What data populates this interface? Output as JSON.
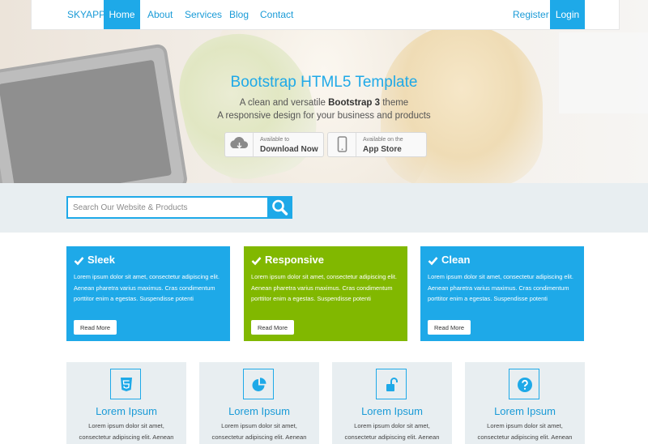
{
  "nav": {
    "brand": "SKYAPP",
    "items": [
      {
        "label": "Home"
      },
      {
        "label": "About"
      },
      {
        "label": "Services"
      },
      {
        "label": "Blog"
      },
      {
        "label": "Contact"
      }
    ],
    "register": "Register",
    "login": "Login"
  },
  "hero": {
    "title": "Bootstrap HTML5 Template",
    "subtitle1_pre": "A clean and versatile ",
    "subtitle1_bold": "Bootstrap 3",
    "subtitle1_post": " theme",
    "subtitle2": "A responsive design for your business and products",
    "download": {
      "small": "Available to",
      "big": "Download Now",
      "icon": "cloud-download-icon"
    },
    "appstore": {
      "small": "Available on the",
      "big": "App Store",
      "icon": "mobile-phone-icon"
    }
  },
  "search": {
    "placeholder": "Search Our Website & Products",
    "icon": "search-icon"
  },
  "features": [
    {
      "title": "Sleek",
      "text": "Lorem ipsum dolor sit amet, consectetur adipiscing elit. Aenean pharetra varius maximus. Cras condimentum porttitor enim a egestas. Suspendisse potenti",
      "button": "Read More",
      "color": "#1ea9e8"
    },
    {
      "title": "Responsive",
      "text": "Lorem ipsum dolor sit amet, consectetur adipiscing elit. Aenean pharetra varius maximus. Cras condimentum porttitor enim a egestas. Suspendisse potenti",
      "button": "Read More",
      "color": "#81b800"
    },
    {
      "title": "Clean",
      "text": "Lorem ipsum dolor sit amet, consectetur adipiscing elit. Aenean pharetra varius maximus. Cras condimentum porttitor enim a egestas. Suspendisse potenti",
      "button": "Read More",
      "color": "#1ea9e8"
    }
  ],
  "tiles": [
    {
      "title": "Lorem Ipsum",
      "text1": "Lorem ipsum dolor sit amet,",
      "text2": "consectetur adipiscing elit. Aenean",
      "icon": "html5-icon"
    },
    {
      "title": "Lorem Ipsum",
      "text1": "Lorem ipsum dolor sit amet,",
      "text2": "consectetur adipiscing elit. Aenean",
      "icon": "pie-chart-icon"
    },
    {
      "title": "Lorem Ipsum",
      "text1": "Lorem ipsum dolor sit amet,",
      "text2": "consectetur adipiscing elit. Aenean",
      "icon": "unlock-icon"
    },
    {
      "title": "Lorem Ipsum",
      "text1": "Lorem ipsum dolor sit amet,",
      "text2": "consectetur adipiscing elit. Aenean",
      "icon": "question-circle-icon"
    }
  ],
  "colors": {
    "accent": "#1ea9e8",
    "green": "#81b800",
    "band": "#e8eef1"
  }
}
